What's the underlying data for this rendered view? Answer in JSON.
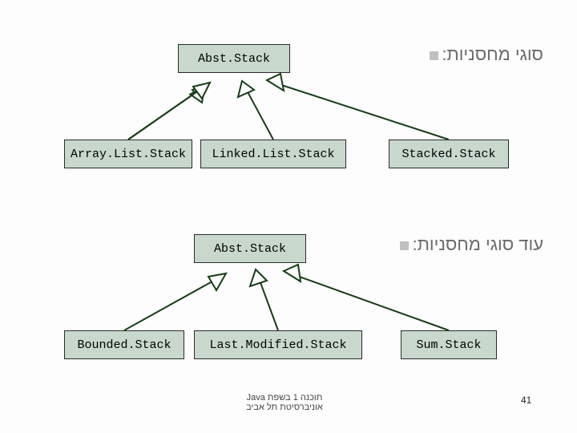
{
  "headings": {
    "stack_types": "סוגי מחסניות:",
    "more_stack_types": "עוד סוגי מחסניות:"
  },
  "diagram1": {
    "parent": "Abst.Stack",
    "children": [
      "Array.List.Stack",
      "Linked.List.Stack",
      "Stacked.Stack"
    ]
  },
  "diagram2": {
    "parent": "Abst.Stack",
    "children": [
      "Bounded.Stack",
      "Last.Modified.Stack",
      "Sum.Stack"
    ]
  },
  "footer": {
    "course_line1": "תוכנה 1 בשפת Java",
    "course_line2": "אוניברסיטת תל אביב",
    "page": "41"
  }
}
